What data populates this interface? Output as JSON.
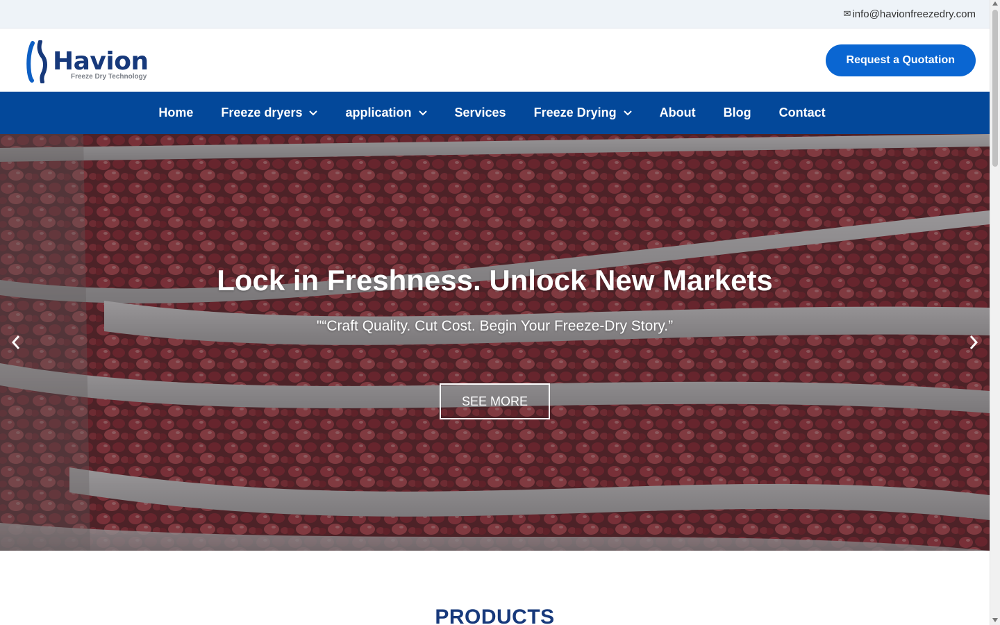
{
  "topbar": {
    "email": "info@havionfreezedry.com",
    "email_icon": "mail-icon",
    "email_icon_glyph": "✉"
  },
  "header": {
    "logo_name": "Havion",
    "logo_tagline": "Freeze Dry Technology",
    "quote_button": "Request a Quotation"
  },
  "nav": {
    "items": [
      {
        "label": "Home",
        "has_dropdown": false
      },
      {
        "label": "Freeze dryers",
        "has_dropdown": true
      },
      {
        "label": "application",
        "has_dropdown": true
      },
      {
        "label": "Services",
        "has_dropdown": false
      },
      {
        "label": "Freeze Drying",
        "has_dropdown": true
      },
      {
        "label": "About",
        "has_dropdown": false
      },
      {
        "label": "Blog",
        "has_dropdown": false
      },
      {
        "label": "Contact",
        "has_dropdown": false
      }
    ]
  },
  "hero": {
    "title": "Lock in Freshness. Unlock New Markets",
    "subtitle": "\"“Craft Quality. Cut Cost. Begin Your Freeze-Dry Story.”",
    "button": "SEE MORE",
    "prev_icon": "chevron-left-icon",
    "next_icon": "chevron-right-icon"
  },
  "products": {
    "heading": "PRODUCTS"
  },
  "colors": {
    "brand_blue": "#03489a",
    "button_blue": "#0a66d2",
    "logo_navy": "#17397b",
    "topbar_bg": "#eef3f8"
  }
}
